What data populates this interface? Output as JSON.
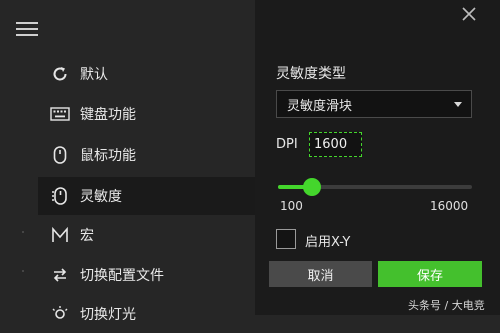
{
  "sidebar": {
    "items": [
      {
        "label": "默认",
        "icon": "refresh-icon"
      },
      {
        "label": "键盘功能",
        "icon": "keyboard-icon"
      },
      {
        "label": "鼠标功能",
        "icon": "mouse-icon"
      },
      {
        "label": "灵敏度",
        "icon": "mouse-sensitivity-icon",
        "active": true
      },
      {
        "label": "宏",
        "icon": "macro-m-icon"
      },
      {
        "label": "切换配置文件",
        "icon": "switch-arrows-icon"
      },
      {
        "label": "切换灯光",
        "icon": "light-bulb-icon"
      }
    ]
  },
  "panel": {
    "section_title": "灵敏度类型",
    "sensitivity_type": {
      "selected": "灵敏度滑块"
    },
    "dpi": {
      "label": "DPI",
      "value": "1600"
    },
    "slider": {
      "min_label": "100",
      "max_label": "16000",
      "min": 100,
      "max": 16000,
      "value": 1600
    },
    "enable_xy": {
      "label": "启用X-Y",
      "checked": false
    },
    "buttons": {
      "cancel": "取消",
      "save": "保存"
    }
  },
  "watermark": "头条号 / 大电竞",
  "colors": {
    "accent": "#44d62c",
    "save_button": "#44c02d",
    "cancel_button": "#4a4a4a"
  }
}
